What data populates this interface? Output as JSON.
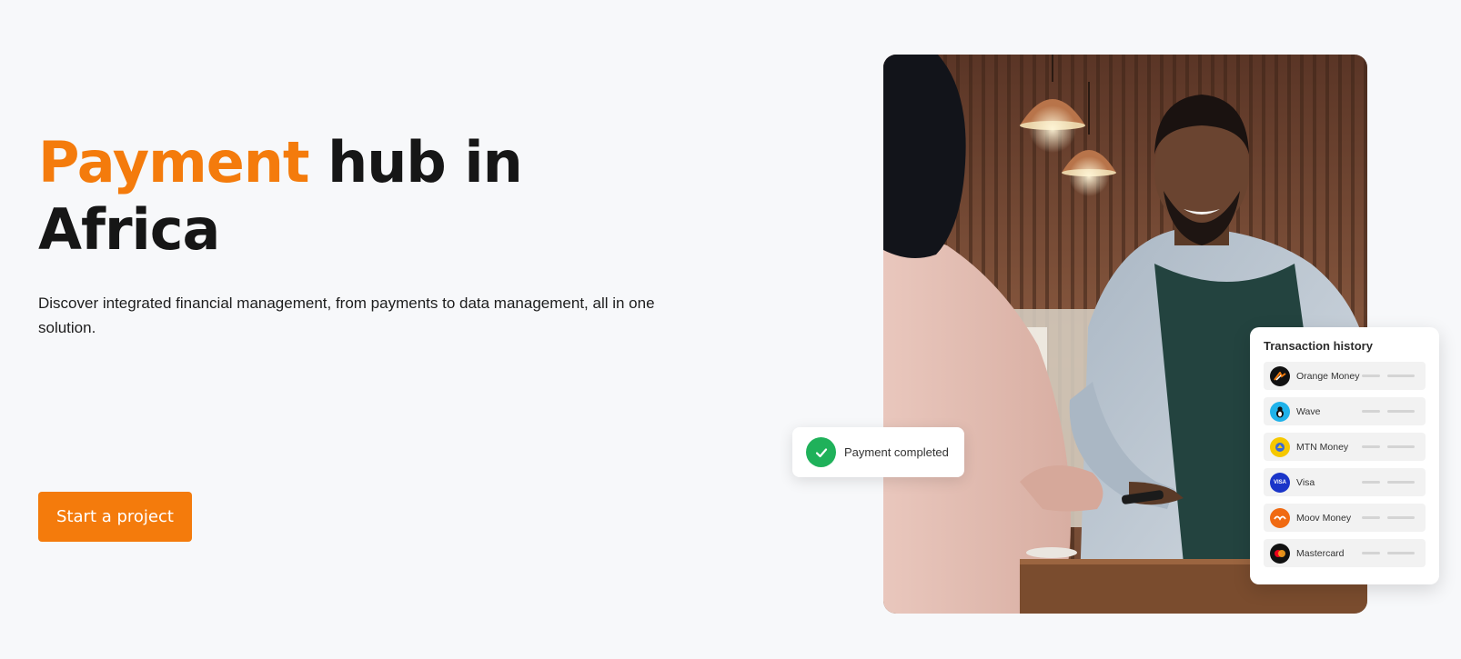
{
  "hero": {
    "headline_accent": "Payment",
    "headline_rest": " hub in Africa",
    "subtitle": "Discover integrated financial management, from payments to data management, all in one solution.",
    "cta_label": "Start a project"
  },
  "payment_card": {
    "label": "Payment completed",
    "icon": "check-icon"
  },
  "transaction_history": {
    "title": "Transaction history",
    "items": [
      {
        "label": "Orange Money",
        "icon": "orange-money-logo",
        "color": "#111111"
      },
      {
        "label": "Wave",
        "icon": "wave-logo",
        "color": "#1fb2ea"
      },
      {
        "label": "MTN Money",
        "icon": "mtn-money-logo",
        "color": "#f6c800"
      },
      {
        "label": "Visa",
        "icon": "visa-logo",
        "color": "#1a35c9"
      },
      {
        "label": "Moov Money",
        "icon": "moov-money-logo",
        "color": "#f06a12"
      },
      {
        "label": "Mastercard",
        "icon": "mastercard-logo",
        "color": "#111111"
      }
    ]
  },
  "colors": {
    "accent": "#f47b0c",
    "background": "#f7f8fa",
    "success": "#1fb15a"
  }
}
